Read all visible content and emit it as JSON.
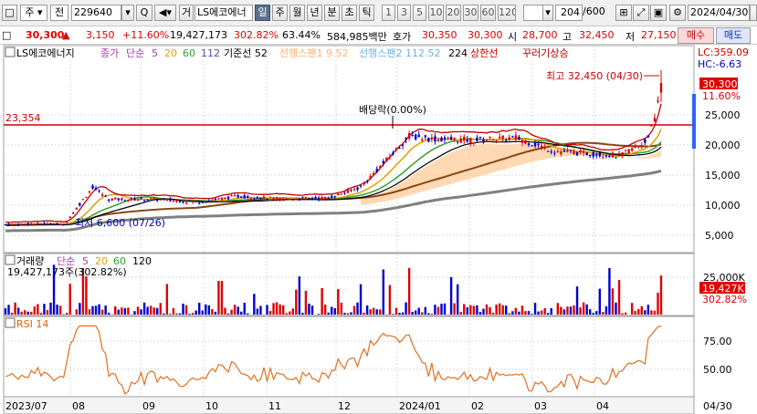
{
  "toolbar": {
    "mode_label": "주",
    "prev_label": "전",
    "code": "229640",
    "search_label": "Q",
    "sound_label": "◀",
    "trade_label": "거",
    "stock_name": "LS에코에너",
    "periods": [
      "일",
      "주",
      "월",
      "년",
      "분",
      "초",
      "틱"
    ],
    "active_period": "일",
    "intervals": [
      "1",
      "3",
      "5",
      "10",
      "20",
      "30",
      "60",
      "120"
    ],
    "count": "204",
    "count_total": "/600",
    "date": "2024/04/30"
  },
  "quote": {
    "price": "30,300",
    "change_arrow": "▲",
    "change": "3,150",
    "change_pct": "+11.60%",
    "volume": "19,427,173",
    "volume_ratio": "302.82%",
    "turnover_pct": "63.44%",
    "amount": "584,985백만",
    "ask_label": "호가",
    "ask": "30,350",
    "bid": "30,300",
    "open_label": "시",
    "open": "28,700",
    "high_label": "고",
    "high": "32,450",
    "low_label": "저",
    "low": "27,150",
    "buy_label": "매수",
    "sell_label": "매도"
  },
  "legend": {
    "name": "LS에코에너지",
    "close_label": "종가",
    "ma_label": "단순",
    "ma_periods": [
      "5",
      "20",
      "60",
      "112"
    ],
    "base_line": "기준선 52",
    "span1": "선행스팬1 9.52",
    "span2": "선행스팬2 112.52",
    "span_extra": "224",
    "upper_limit": "상한선",
    "upper_limit2": "꾸러기상승"
  },
  "annotations": {
    "high_point": "최고 32,450 (04/30)",
    "low_point": "최저 6,600 (07/26)",
    "dividend": "배당락(0.00%)",
    "hline_label": "23,354",
    "lc": "LC:359.09",
    "hc": "HC:-6.63",
    "last_price": "30,300",
    "last_pct": "11.60%"
  },
  "volume_panel": {
    "title": "거래량",
    "ma_label": "단순",
    "ma_periods": [
      "5",
      "20",
      "60",
      "120"
    ],
    "value_text": "19,427,173주(302.82%)",
    "axis_label": "25,000K",
    "last_value": "19,427K",
    "last_pct": "302.82%"
  },
  "rsi_panel": {
    "title": "RSI 14",
    "ticks": [
      "75.00",
      "50.00"
    ]
  },
  "x_axis": {
    "labels": [
      "2023/07",
      "08",
      "09",
      "10",
      "11",
      "12",
      "2024/01",
      "02",
      "03",
      "04"
    ],
    "right_label": "04/30"
  },
  "price_axis": [
    "25,000",
    "20,000",
    "15,000",
    "10,000",
    "5,000"
  ],
  "colors": {
    "up": "#e00000",
    "down": "#0000d0",
    "ma5": "#b03ab0",
    "ma20": "#e0a000",
    "ma60": "#30a030",
    "ma112": "#000000",
    "span": "#ff9a30",
    "cloud": "#ffd0a0"
  }
}
